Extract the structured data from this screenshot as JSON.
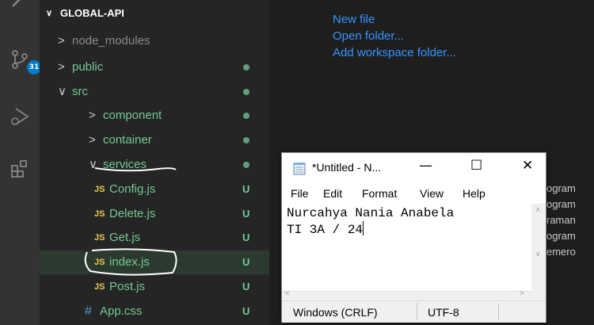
{
  "activity_bar": {
    "icons": [
      "search-icon",
      "source-control-icon",
      "run-debug-icon",
      "extensions-icon"
    ],
    "source_control_badge": "31"
  },
  "explorer": {
    "root_folder": "GLOBAL-API",
    "items": [
      {
        "label": "node_modules",
        "type": "folder",
        "expanded": false,
        "status": ""
      },
      {
        "label": "public",
        "type": "folder",
        "expanded": false,
        "status": "dot"
      },
      {
        "label": "src",
        "type": "folder",
        "expanded": true,
        "status": "dot"
      },
      {
        "label": "component",
        "type": "folder",
        "expanded": false,
        "status": "dot"
      },
      {
        "label": "container",
        "type": "folder",
        "expanded": false,
        "status": "dot"
      },
      {
        "label": "services",
        "type": "folder",
        "expanded": true,
        "status": "dot"
      },
      {
        "label": "Config.js",
        "type": "js",
        "status": "U"
      },
      {
        "label": "Delete.js",
        "type": "js",
        "status": "U"
      },
      {
        "label": "Get.js",
        "type": "js",
        "status": "U"
      },
      {
        "label": "index.js",
        "type": "js",
        "status": "U"
      },
      {
        "label": "Post.js",
        "type": "js",
        "status": "U"
      },
      {
        "label": "App.css",
        "type": "css",
        "status": "U"
      }
    ],
    "js_badge": "JS",
    "css_badge": "#"
  },
  "welcome": {
    "links": [
      "New file",
      "Open folder...",
      "Add workspace folder..."
    ]
  },
  "background_text": [
    "ogram",
    "ogram",
    "raman",
    "ogram",
    "emero"
  ],
  "notepad": {
    "title": "*Untitled - N...",
    "minimize": "—",
    "maximize": "☐",
    "close": "✕",
    "menu": [
      "File",
      "Edit",
      "Format",
      "View",
      "Help"
    ],
    "text_lines": [
      "Nurcahya Nania Anabela",
      "TI 3A / 24"
    ],
    "status": {
      "line_ending": "Windows (CRLF)",
      "encoding": "UTF-8"
    }
  },
  "colors": {
    "accent": "#007acc",
    "untracked": "#73c991",
    "link": "#3794ff",
    "js_badge": "#e8c94f"
  }
}
